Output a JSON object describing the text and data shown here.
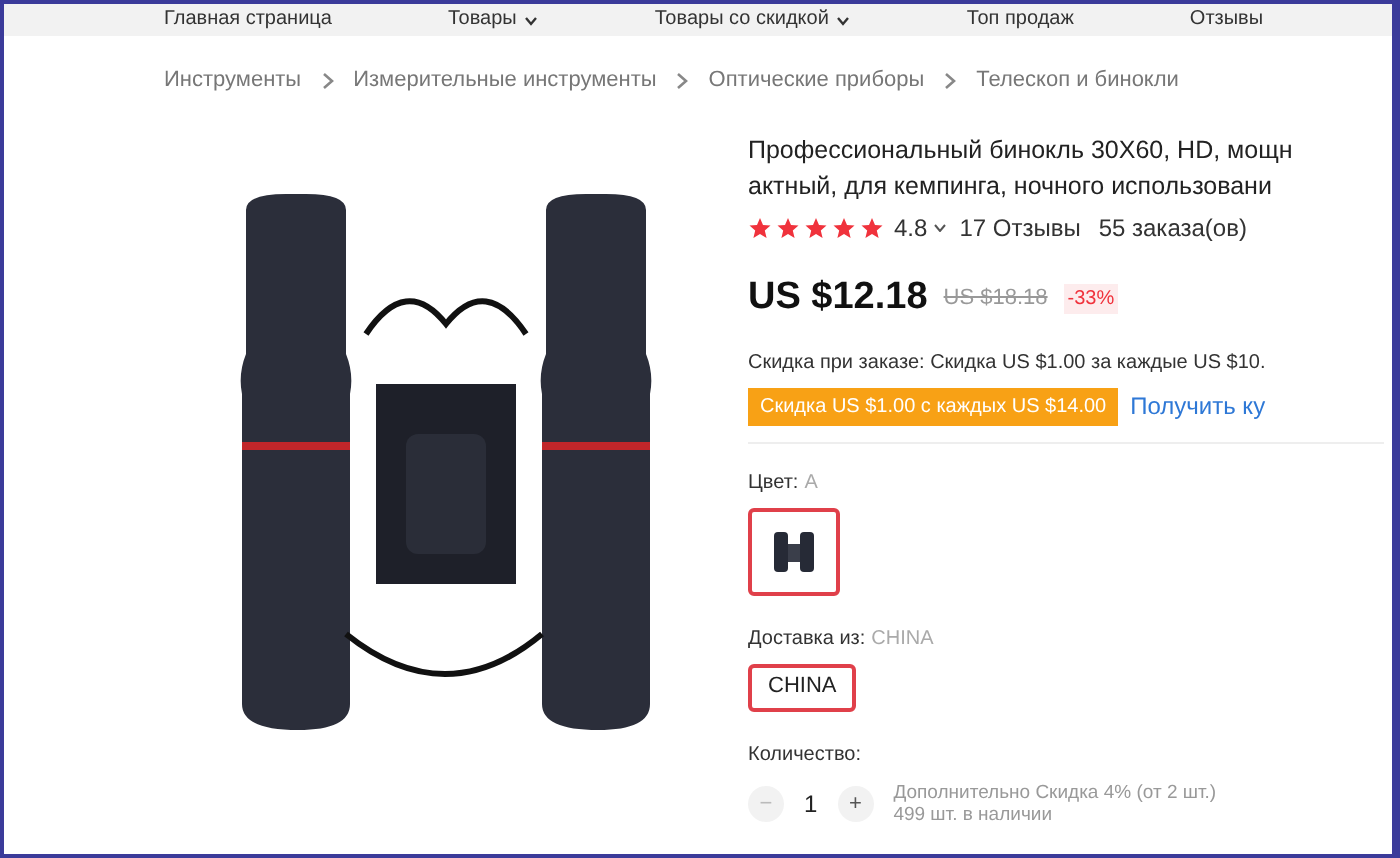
{
  "nav": [
    {
      "label": "Главная страница",
      "dropdown": false
    },
    {
      "label": "Товары",
      "dropdown": true
    },
    {
      "label": "Товары со скидкой",
      "dropdown": true
    },
    {
      "label": "Топ продаж",
      "dropdown": false
    },
    {
      "label": "Отзывы",
      "dropdown": false
    }
  ],
  "breadcrumbs": [
    "Инструменты",
    "Измерительные инструменты",
    "Оптические приборы",
    "Телескоп и бинокли"
  ],
  "product": {
    "title_lines": [
      "Профессиональный бинокль 30X60, HD, мощн",
      "актный, для кемпинга, ночного использовани"
    ],
    "rating": {
      "stars": 5,
      "score": "4.8",
      "reviews": "17 Отзывы",
      "orders": "55 заказа(ов)"
    },
    "price": "US $12.18",
    "old_price": "US $18.18",
    "discount": "-33%",
    "order_discount": "Скидка при заказе: Скидка US $1.00 за каждые US $10.",
    "coupon": "Скидка US $1.00 с каждых US $14.00",
    "coupon_link": "Получить ку",
    "color_label": "Цвет:",
    "color_value": "A",
    "color_options": [
      {
        "selected": true
      }
    ],
    "ship_label": "Доставка из:",
    "ship_value": "CHINA",
    "ship_options": [
      {
        "label": "CHINA",
        "selected": true
      }
    ],
    "qty_label": "Количество:",
    "qty_minus": "−",
    "qty": "1",
    "qty_plus": "+",
    "qty_note": "Дополнительно Скидка 4% (от 2 шт.)",
    "stock": "499 шт. в наличии"
  }
}
